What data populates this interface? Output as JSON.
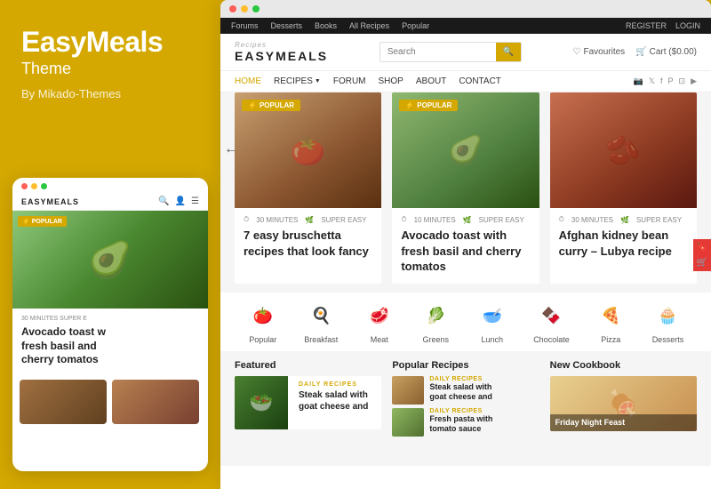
{
  "brand": {
    "title": "EasyMeals",
    "subtitle": "Theme",
    "by": "By Mikado-Themes"
  },
  "browser": {
    "dots": [
      "#ff5f57",
      "#ffbd2e",
      "#28c840"
    ]
  },
  "admin_bar": {
    "left": [
      "Forums",
      "Desserts",
      "Books",
      "All Recipes",
      "Popular"
    ],
    "right": [
      "REGISTER",
      "LOGIN"
    ]
  },
  "site": {
    "logo_top": "Recipes",
    "logo": "EASYMEALS",
    "search_placeholder": "Search",
    "favourites": "Favourites",
    "cart": "Cart ($0.00)"
  },
  "nav": {
    "items": [
      "HOME",
      "RECIPES",
      "FORUM",
      "SHOP",
      "ABOUT",
      "CONTACT"
    ]
  },
  "recipe_cards": [
    {
      "badge": "POPULAR",
      "meta1": "30 MINUTES",
      "meta2": "SUPER EASY",
      "title": "7 easy bruschetta recipes that look fancy"
    },
    {
      "badge": "POPULAR",
      "meta1": "10 MINUTES",
      "meta2": "SUPER EASY",
      "title": "Avocado toast with fresh basil and cherry tomatos"
    },
    {
      "badge": "",
      "meta1": "30 MINUTES",
      "meta2": "SUPER EASY",
      "title": "Afghan kidney bean curry – Lubya recipe"
    }
  ],
  "categories": [
    {
      "label": "Popular",
      "icon": "🍅"
    },
    {
      "label": "Breakfast",
      "icon": "🍳"
    },
    {
      "label": "Meat",
      "icon": "🥩"
    },
    {
      "label": "Greens",
      "icon": "🥬"
    },
    {
      "label": "Lunch",
      "icon": "🥣"
    },
    {
      "label": "Chocolate",
      "icon": "🍫"
    },
    {
      "label": "Pizza",
      "icon": "🍕"
    },
    {
      "label": "Desserts",
      "icon": "🧁"
    }
  ],
  "sections": {
    "featured_title": "Featured",
    "popular_title": "Popular Recipes",
    "cookbook_title": "New Cookbook"
  },
  "featured": {
    "label": "DAILY RECIPES",
    "title": "Steak salad with goat cheese and"
  },
  "popular_recipes": [
    {
      "label": "DAILY RECIPES",
      "title": "Steak salad with goat cheese and"
    },
    {
      "label": "DAILY RECIPES",
      "title": "Fresh pasta with tomato sauce"
    }
  ],
  "cookbook": {
    "title": "Friday Night Feast"
  },
  "mobile": {
    "logo": "EASYMEALS",
    "badge": "POPULAR",
    "card_title": "Avocado toast with fresh basil and cherry tomatos",
    "meta": "30 MINUTES  SUPER E"
  }
}
